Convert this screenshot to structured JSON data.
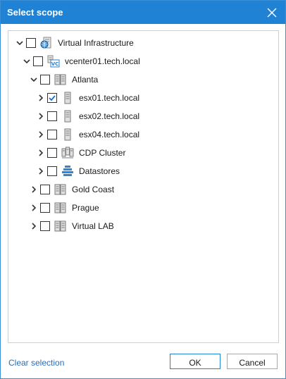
{
  "dialog": {
    "title": "Select scope"
  },
  "tree": [
    {
      "label": "Virtual Infrastructure",
      "icon": "globe-server-icon",
      "level": 0,
      "expanded": true,
      "checked": false
    },
    {
      "label": "vcenter01.tech.local",
      "icon": "vcenter-icon",
      "level": 1,
      "expanded": true,
      "checked": false
    },
    {
      "label": "Atlanta",
      "icon": "datacenter-icon",
      "level": 2,
      "expanded": true,
      "checked": false
    },
    {
      "label": "esx01.tech.local",
      "icon": "host-icon",
      "level": 3,
      "expanded": false,
      "checked": true
    },
    {
      "label": "esx02.tech.local",
      "icon": "host-icon",
      "level": 3,
      "expanded": false,
      "checked": false
    },
    {
      "label": "esx04.tech.local",
      "icon": "host-icon",
      "level": 3,
      "expanded": false,
      "checked": false
    },
    {
      "label": "CDP Cluster",
      "icon": "cluster-icon",
      "level": 3,
      "expanded": false,
      "checked": false
    },
    {
      "label": "Datastores",
      "icon": "datastore-icon",
      "level": 3,
      "expanded": false,
      "checked": false
    },
    {
      "label": "Gold Coast",
      "icon": "datacenter-icon",
      "level": 2,
      "expanded": false,
      "checked": false
    },
    {
      "label": "Prague",
      "icon": "datacenter-icon",
      "level": 2,
      "expanded": false,
      "checked": false
    },
    {
      "label": "Virtual LAB",
      "icon": "datacenter-icon",
      "level": 2,
      "expanded": false,
      "checked": false
    }
  ],
  "footer": {
    "clear_label": "Clear selection",
    "ok_label": "OK",
    "cancel_label": "Cancel"
  },
  "colors": {
    "titlebar": "#1f82d4",
    "accent": "#1f6fc2",
    "check": "#1f6fc2"
  }
}
